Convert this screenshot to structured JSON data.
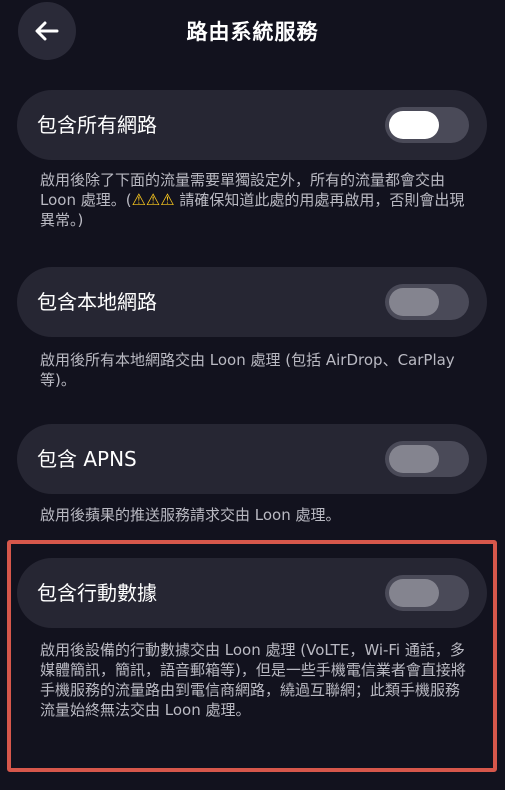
{
  "header": {
    "title": "路由系統服務",
    "back_icon": "arrow-left-icon"
  },
  "settings": [
    {
      "label": "包含所有網路",
      "enabled": true,
      "description_before": "啟用後除了下面的流量需要單獨設定外，所有的流量都會交由 Loon 處理。(",
      "warning_icons": "⚠⚠⚠",
      "description_after": " 請確保知道此處的用處再啟用，否則會出現異常。)"
    },
    {
      "label": "包含本地網路",
      "enabled": false,
      "description": "啟用後所有本地網路交由 Loon 處理 (包括 AirDrop、CarPlay 等)。"
    },
    {
      "label": "包含 APNS",
      "enabled": false,
      "description": "啟用後蘋果的推送服務請求交由 Loon 處理。"
    },
    {
      "label": "包含行動數據",
      "enabled": false,
      "highlighted": true,
      "description": "啟用後設備的行動數據交由 Loon 處理 (VoLTE，Wi-Fi 通話，多媒體簡訊，簡訊，語音郵箱等)，但是一些手機電信業者會直接將手機服務的流量路由到電信商網路，繞過互聯網；此類手機服務流量始終無法交由 Loon 處理。"
    }
  ],
  "colors": {
    "background": "#12121e",
    "row_background": "#262633",
    "toggle_track": "#4a4a58",
    "toggle_on_knob": "#ffffff",
    "toggle_off_knob": "#84848f",
    "highlight_border": "#d6574b",
    "warning": "#ffcc1f"
  }
}
